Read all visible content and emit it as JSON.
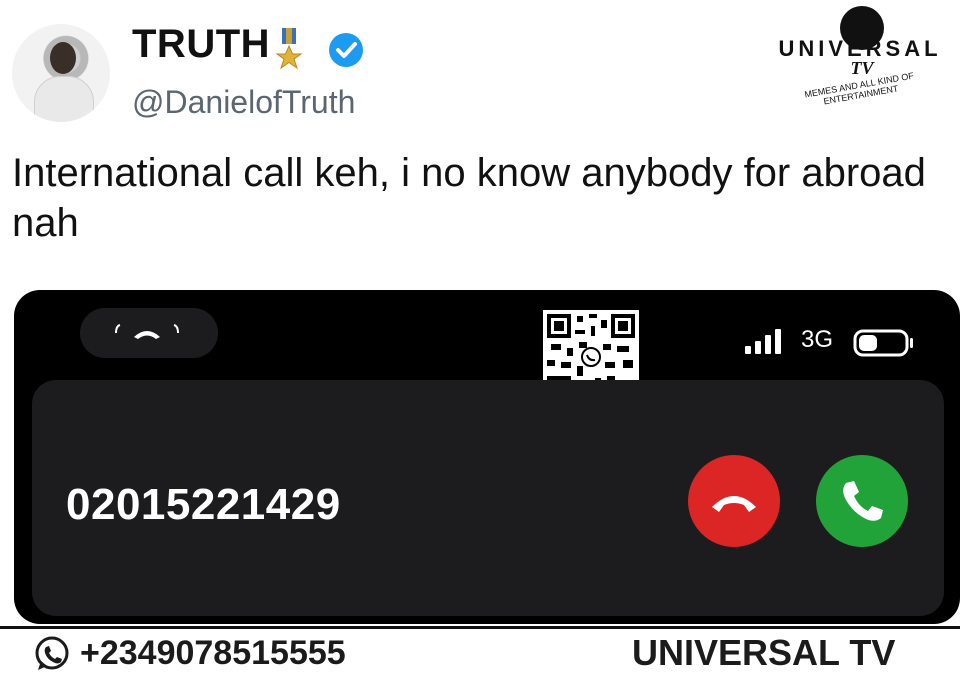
{
  "tweet": {
    "display_name": "TRUTH",
    "handle": "@DanielofTruth",
    "text": "International call keh, i no know anybody for abroad nah",
    "icons": [
      "medal-icon",
      "verified-icon"
    ]
  },
  "logo": {
    "title": "UNIVERSAL",
    "tv": "TV",
    "tagline": "MEMES AND ALL KIND OF ENTERTAINMENT"
  },
  "call_screen": {
    "network": "3G",
    "caller_number": "02015221429",
    "icons": [
      "decline-call-icon",
      "accept-call-icon",
      "signal-icon",
      "battery-icon",
      "qr-code"
    ],
    "colors": {
      "decline": "#dc2525",
      "accept": "#22a33a",
      "background": "#000000",
      "card": "#1c1c1e"
    }
  },
  "footer": {
    "phone": "+2349078515555",
    "brand": "UNIVERSAL TV",
    "icons": [
      "whatsapp-icon"
    ]
  }
}
